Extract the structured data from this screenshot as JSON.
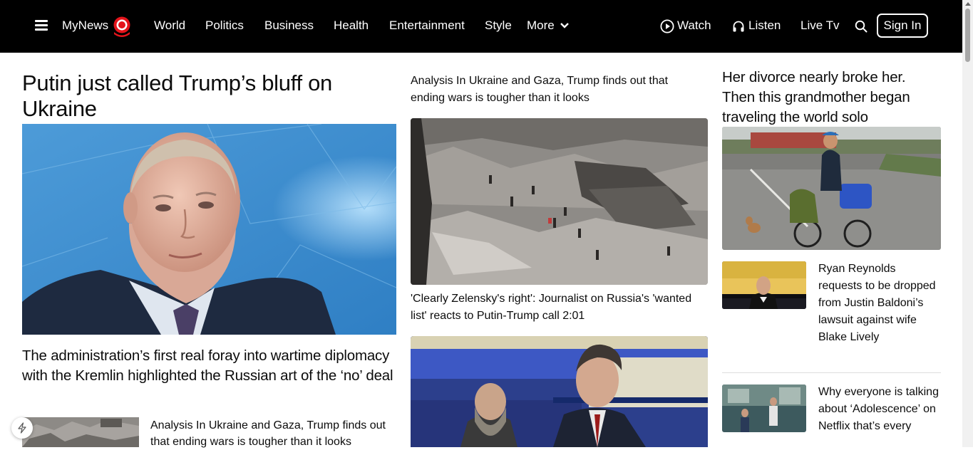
{
  "header": {
    "menu_icon": "hamburger-menu-icon",
    "logo_text": "MyNews",
    "logo_icon": "red-eye-logo-icon",
    "nav": [
      "World",
      "Politics",
      "Business",
      "Health",
      "Entertainment",
      "Style"
    ],
    "more_label": "More",
    "watch_label": "Watch",
    "listen_label": "Listen",
    "livetv_label": "Live Tv",
    "search_icon": "search-icon",
    "signin_label": "Sign In"
  },
  "left": {
    "main_headline": "Putin just called Trump’s bluff on Ukraine",
    "main_image": "putin-portrait-photo",
    "sub_headline": "The administration’s first real foray into wartime diplomacy with the Kremlin highlighted the Russian art of the ‘no’ deal",
    "thumb_image": "gaza-rubble-thumbnail",
    "small_headline": "Analysis In Ukraine and Gaza, Trump finds out that ending wars is tougher than it looks"
  },
  "middle": {
    "top_headline": "Analysis In Ukraine and Gaza, Trump finds out that ending wars is tougher than it looks",
    "rubble_image": "gaza-rubble-photo",
    "video_headline": "'Clearly Zelensky's right': Journalist on Russia's 'wanted list' reacts to Putin-Trump call 2:01",
    "interview_image": "interview-photo"
  },
  "right": {
    "feature_headline": "Her divorce nearly broke her. Then this grandmother began traveling the world solo",
    "feature_image": "grandmother-cycling-photo",
    "stories": [
      {
        "headline": "Ryan Reynolds requests to be dropped from Justin Baldoni’s lawsuit against wife Blake Lively",
        "image": "ryan-reynolds-thumbnail"
      },
      {
        "headline": "Why everyone is talking about ‘Adolescence’ on Netflix that’s every",
        "image": "adolescence-thumbnail"
      }
    ]
  },
  "colors": {
    "topbar": "#000000",
    "logo_red": "#e4141b",
    "text": "#0c0c0c"
  }
}
